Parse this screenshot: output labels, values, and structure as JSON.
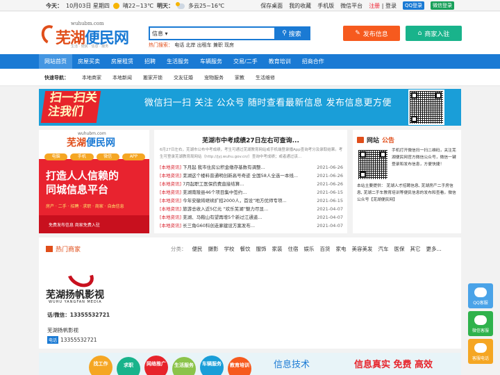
{
  "topbar": {
    "today_label": "今天：",
    "date": "10月03日 星期四",
    "weather_today": "晴22~13℃",
    "tomorrow_label": "明天：",
    "weather_tomorrow": "多云25~16℃",
    "links": [
      "保存桌面",
      "我的收藏",
      "手机版",
      "微信平台"
    ],
    "register": "注册",
    "login": "登录",
    "qq_login": "QQ登录",
    "wechat_login": "微信登录"
  },
  "header": {
    "logo_domain": "wuhubm.com",
    "logo_text_a": "芜湖",
    "logo_text_b": "便民网",
    "logo_tag": "生活 · 便民 · 信息 · 服务",
    "search_select": "信息",
    "search_button": "搜索",
    "hot_label": "热门搜索：",
    "hot_words": "电话 北岸 出租车 兼职 现房",
    "publish_button": "发布信息",
    "join_button": "商家入驻"
  },
  "nav": {
    "items": [
      "网站首页",
      "房屋买卖",
      "房屋租赁",
      "招聘",
      "生活服务",
      "车辆服务",
      "交易/二手",
      "教育培训",
      "招商合作"
    ]
  },
  "subnav": {
    "label": "快速导航：",
    "items": [
      "本地商家",
      "本地新闻",
      "搬家开锁",
      "交友征婚",
      "宠物服务",
      "家教",
      "生活维修"
    ]
  },
  "banner": {
    "left_text": "扫一扫关注我们",
    "text": "微信扫一扫 关注 公众号 随时查看最新信息 发布信息更方便"
  },
  "promo": {
    "domain": "wuhubm.com",
    "name_a": "芜湖",
    "name_b": "便民网",
    "channels": [
      "电脑",
      "手机",
      "微信",
      "APP"
    ],
    "slogan_1": "打造人人信赖的",
    "slogan_2": "同城信息平台",
    "services": "房产 · 二手 · 招聘 · 求职 · 商家 · 自由信息",
    "footer": "免费发布信息 商家免费入驻"
  },
  "news": {
    "title": "芜湖市中考成绩27日左右可查询...",
    "summary": "6月27日左右，芜湖市公布中考成绩，考生可通过芜湖教育网站或手机端登录播App查询考分及录取结果。考生可登录芜湖教育局网站（http://jyj.wuhu.gov.cn/）查询中考成绩；或者通过该...",
    "items": [
      {
        "cat": "[本地资讯]",
        "title": "下月起 我市住房公积金缴存基数有调整...",
        "date": "2021-06-26"
      },
      {
        "cat": "[本地资讯]",
        "title": "芜湖这个楼料普通明创新高号奇迹 全国58人全选一本线...",
        "date": "2021-06-26"
      },
      {
        "cat": "[本地资讯]",
        "title": "7月起职工医保药费直接结算...",
        "date": "2021-06-26"
      },
      {
        "cat": "[本地资讯]",
        "title": "芜湖南陵县46个项目集中签约...",
        "date": "2021-06-15"
      },
      {
        "cat": "[本地资讯]",
        "title": "今年安徽将继续扩招2000人，首设“地方优师专项...",
        "date": "2021-06-15"
      },
      {
        "cat": "[本地资讯]",
        "title": "旅游总收入近5亿元 “欢乐芜湖”魅力尽显...",
        "date": "2021-04-07"
      },
      {
        "cat": "[本地资讯]",
        "title": "芜湖、马鞍山有望再增5个新过江通道...",
        "date": "2021-04-07"
      },
      {
        "cat": "[本地资讯]",
        "title": "长三角G60科创走廊建设方案发布...",
        "date": "2021-04-07"
      }
    ]
  },
  "notice": {
    "title_a": "网站",
    "title_b": "公告",
    "p1": "手机打开微信扫一扫二维码，关注芜湖便民网官方微信公众号，微信一键登录和发布信息，方便快捷！",
    "p2": "本站主要提供： 芜湖人才招聘信息, 芜湖房产二手房信息, 芜湖二手车教育培训等便民信息的发布和查看，微信公众号【芜湖便民网】"
  },
  "biz": {
    "title": "热门商家",
    "cat_label": "分类：",
    "cats": [
      "便民",
      "摄影",
      "学校",
      "餐饮",
      "服饰",
      "家装",
      "住宿",
      "娱乐",
      "百货",
      "家电",
      "美容美发",
      "汽车",
      "医保",
      "其它",
      "更多..."
    ],
    "merchant_logo_text": "芜湖扬帆影视",
    "merchant_logo_en": "WUHU YANGFAN MEDIA",
    "tel_line": "话/微信：13355532721",
    "merchant_name": "芜湖扬帆影视",
    "tel_badge": "电话",
    "tel": "13355532721"
  },
  "footer_banner": {
    "bubbles": [
      "找工作",
      "求职",
      "网络推广",
      "生活服务",
      "车辆服务",
      "教育培训"
    ],
    "text_info": "信息技术",
    "text_right": "信息真实  免费  高效"
  },
  "side": {
    "qq": "QQ客服",
    "wechat": "微信客服",
    "phone": "客服电话"
  },
  "colors": {
    "primary": "#1a7ad4",
    "accent": "#e04e1a",
    "publish": "#f65a1e",
    "join": "#19b38b",
    "news_cat": "#d9232e"
  }
}
